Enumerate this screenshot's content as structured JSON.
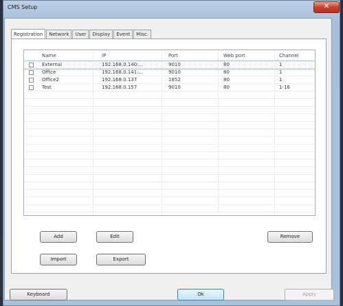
{
  "window": {
    "title": "CMS Setup",
    "close_glyph": "✕"
  },
  "tabs": [
    {
      "label": "Registration",
      "active": true
    },
    {
      "label": "Network"
    },
    {
      "label": "User"
    },
    {
      "label": "Display"
    },
    {
      "label": "Event"
    },
    {
      "label": "Misc."
    }
  ],
  "table": {
    "columns": [
      "Name",
      "IP",
      "Port",
      "Web port",
      "Channel"
    ],
    "rows": [
      {
        "name": "External",
        "ip": "192.168.0.140:...",
        "port": "9010",
        "web_port": "80",
        "channel": "1"
      },
      {
        "name": "Office",
        "ip": "192.168.0.141:...",
        "port": "9010",
        "web_port": "80",
        "channel": "1"
      },
      {
        "name": "Office2",
        "ip": "192.168.0.137",
        "port": "1852",
        "web_port": "80",
        "channel": "1"
      },
      {
        "name": "Test",
        "ip": "192.168.0.157",
        "port": "9010",
        "web_port": "80",
        "channel": "1-16"
      }
    ]
  },
  "buttons": {
    "add": "Add",
    "edit": "Edit",
    "remove": "Remove",
    "import": "Import",
    "export": "Export",
    "keyboard": "Keyboard",
    "ok": "Ok",
    "apply": "Apply"
  },
  "colors": {
    "ok_accent": "#3c7fb1",
    "close_red": "#c8432d"
  }
}
